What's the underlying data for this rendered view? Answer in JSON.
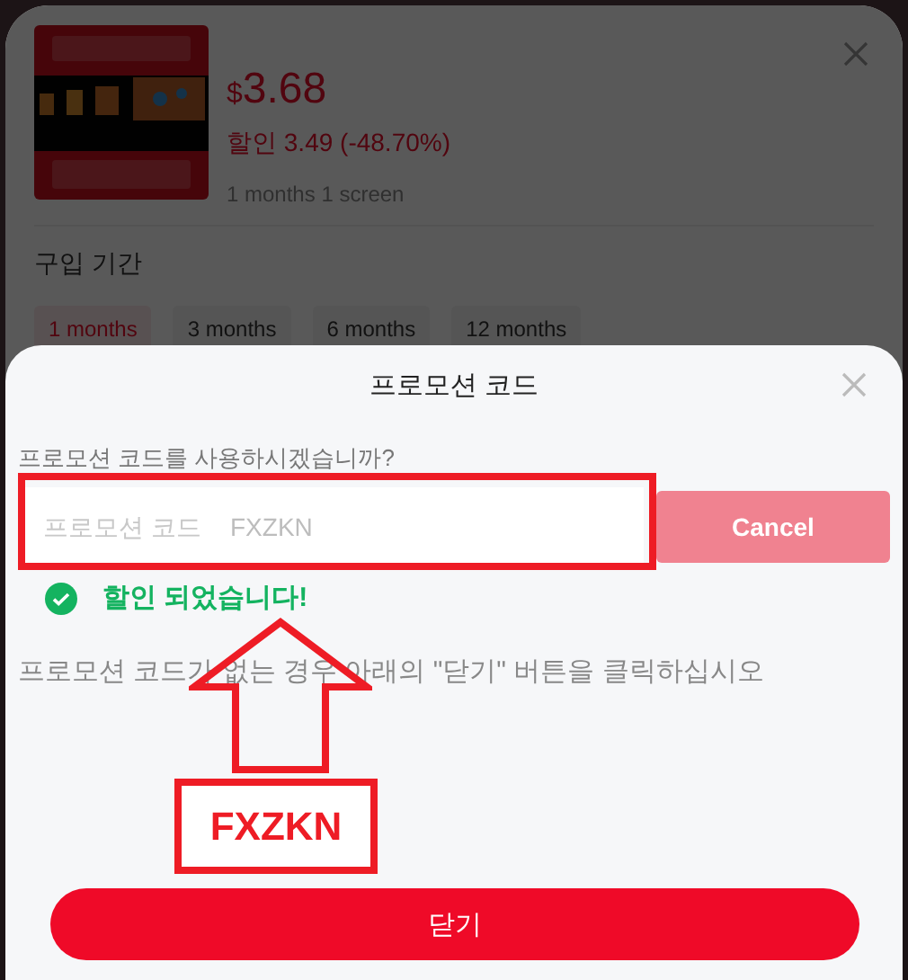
{
  "product": {
    "currency": "$",
    "price": "3.68",
    "discount": "할인 3.49 (-48.70%)",
    "plan": "1 months 1 screen"
  },
  "period": {
    "label": "구입 기간",
    "options": [
      {
        "label": "1 months",
        "selected": true
      },
      {
        "label": "3 months",
        "selected": false
      },
      {
        "label": "6 months",
        "selected": false
      },
      {
        "label": "12 months",
        "selected": false
      }
    ]
  },
  "promo_dialog": {
    "title": "프로모션 코드",
    "question": "프로모션 코드를 사용하시겠습니까?",
    "field": {
      "label": "프로모션 코드",
      "value": "FXZKN"
    },
    "cancel_button": "Cancel",
    "success": "할인 되었습니다!",
    "hint": "프로모션 코드가 없는 경우 아래의 \"닫기\" 버튼을 클릭하십시오",
    "close_button": "닫기"
  },
  "annotation": {
    "callout": "FXZKN"
  }
}
